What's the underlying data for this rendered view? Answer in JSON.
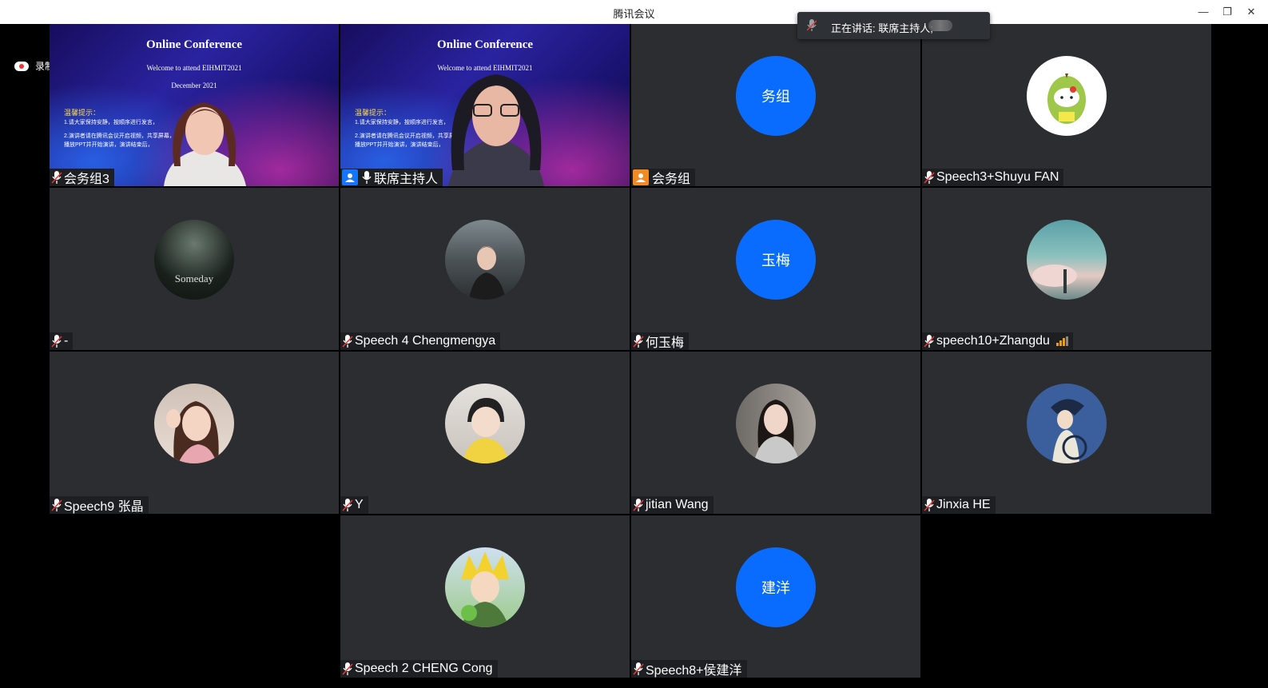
{
  "window": {
    "title": "腾讯会议",
    "controls": {
      "minimize": "—",
      "restore": "❐",
      "close": "✕"
    }
  },
  "speaking_banner": {
    "text": "正在讲话: 联席主持人;"
  },
  "recording": {
    "text": "录制中"
  },
  "slide": {
    "title": "Online Conference",
    "subtitle": "Welcome to attend EIHMIT2021",
    "date": "December 2021",
    "note_title": "温馨提示：",
    "line1": "1.请大家保持安静，按顺序进行发言，",
    "line2": "2.演讲者请在腾讯会议开启视频，共享屏幕，",
    "line3": "播放PPT并开始演讲，演讲结束后，"
  },
  "participants": [
    {
      "name": "会务组3",
      "type": "video",
      "muted": true
    },
    {
      "name": "联席主持人",
      "type": "video",
      "host": true,
      "speaking": true
    },
    {
      "name": "会务组",
      "type": "initials",
      "initials": "务组",
      "host": true,
      "host_color": "#f08a24"
    },
    {
      "name": "Speech3+Shuyu FAN",
      "type": "photo",
      "muted": true,
      "avatar_icon": "kitty-pear-avatar"
    },
    {
      "name": "-",
      "type": "photo",
      "muted": true,
      "avatar_text": "Someday"
    },
    {
      "name": "Speech 4 Chengmengya",
      "type": "photo",
      "muted": true
    },
    {
      "name": "何玉梅",
      "type": "initials",
      "initials": "玉梅",
      "muted": true
    },
    {
      "name": "speech10+Zhangdu",
      "type": "photo",
      "muted": true,
      "signal": true
    },
    {
      "name": "Speech9 张晶",
      "type": "photo",
      "muted": true
    },
    {
      "name": "Y",
      "type": "photo",
      "muted": true
    },
    {
      "name": "jitian Wang",
      "type": "photo",
      "muted": true
    },
    {
      "name": "Jinxia HE",
      "type": "photo",
      "muted": true
    },
    {
      "name": "Speech 2 CHENG Cong",
      "type": "photo",
      "muted": true
    },
    {
      "name": "Speech8+侯建洋",
      "type": "initials",
      "initials": "建洋",
      "muted": true
    }
  ],
  "colors": {
    "tile_bg": "#2b2d31",
    "avatar_blue": "#0a6cff",
    "label_bg": "#1e1f22",
    "active_border": "#27b36b"
  }
}
